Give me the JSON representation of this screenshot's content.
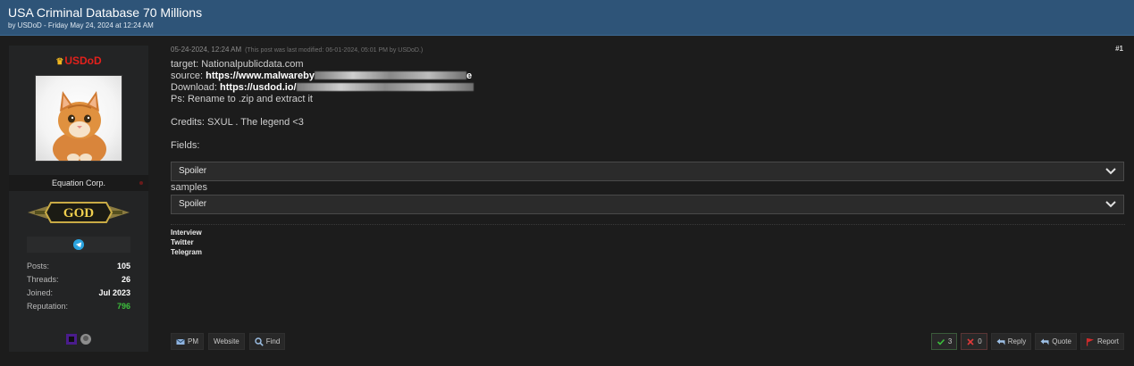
{
  "thread": {
    "title": "USA Criminal Database 70 Millions",
    "subtitle": "by USDoD - Friday May 24, 2024 at 12:24 AM"
  },
  "user": {
    "name": "USDoD",
    "usertitle": "Equation Corp.",
    "rank": "GOD",
    "stats": [
      {
        "label": "Posts:",
        "value": "105"
      },
      {
        "label": "Threads:",
        "value": "26"
      },
      {
        "label": "Joined:",
        "value": "Jul 2023"
      },
      {
        "label": "Reputation:",
        "value": "796"
      }
    ]
  },
  "post": {
    "date": "05-24-2024, 12:24 AM",
    "modified": "(This post was last modified: 06-01-2024, 05:01 PM by USDoD.)",
    "number": "#1",
    "line_target": "target: Nationalpublicdata.com",
    "source_label": "source: ",
    "source_link": "https://www.malwareby",
    "source_tail": "e",
    "download_label": "Download: ",
    "download_link": "https://usdod.io/",
    "ps": "Ps: Rename to .zip and extract it",
    "credits": "Credits: SXUL . The legend <3",
    "fields": "Fields:",
    "samples": "samples",
    "spoiler1": "Spoiler",
    "spoiler2": "Spoiler"
  },
  "signature": [
    "Interview",
    "Twitter",
    "Telegram"
  ],
  "buttons": {
    "pm": "PM",
    "website": "Website",
    "find": "Find",
    "upvotes": "3",
    "downvotes": "0",
    "reply": "Reply",
    "quote": "Quote",
    "report": "Report"
  },
  "colors": {
    "header_bg": "#2e5478",
    "username": "#e2211c",
    "reputation": "#3cbf3c",
    "telegram": "#2aa3df"
  },
  "icons": {
    "crown": "crown-icon",
    "telegram": "telegram-icon",
    "pm": "envelope-icon",
    "find": "search-icon",
    "upvote": "check-icon",
    "downvote": "x-icon",
    "reply": "reply-icon",
    "quote": "quote-icon",
    "report": "flag-icon",
    "spoiler": "chevron-down-icon"
  }
}
